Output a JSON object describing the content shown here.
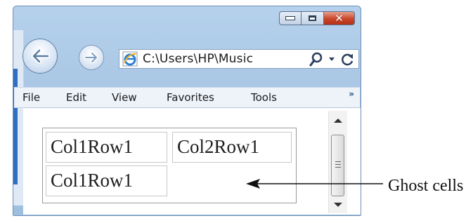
{
  "window": {
    "caption_buttons": {
      "minimize": "minimize",
      "maximize": "maximize",
      "close": "close"
    }
  },
  "address_bar": {
    "url": "C:\\Users\\HP\\Music",
    "icons": [
      "ie-page-icon",
      "search-icon",
      "dropdown-arrow-icon",
      "refresh-icon"
    ]
  },
  "nav": {
    "icons": [
      "back-arrow-icon",
      "forward-arrow-icon"
    ]
  },
  "menu": {
    "items": [
      {
        "label": "File"
      },
      {
        "label": "Edit"
      },
      {
        "label": "View"
      },
      {
        "label": "Favorites"
      },
      {
        "label": "Tools"
      }
    ],
    "more": "»"
  },
  "table": {
    "rows": [
      [
        "Col1Row1",
        "Col2Row1"
      ],
      [
        "Col1Row1",
        ""
      ]
    ]
  },
  "annotation": {
    "label": "Ghost cells"
  },
  "colors": {
    "titlebar": "#a9c6e4",
    "close_button": "#c9452a",
    "content_bg": "#ffffff"
  }
}
